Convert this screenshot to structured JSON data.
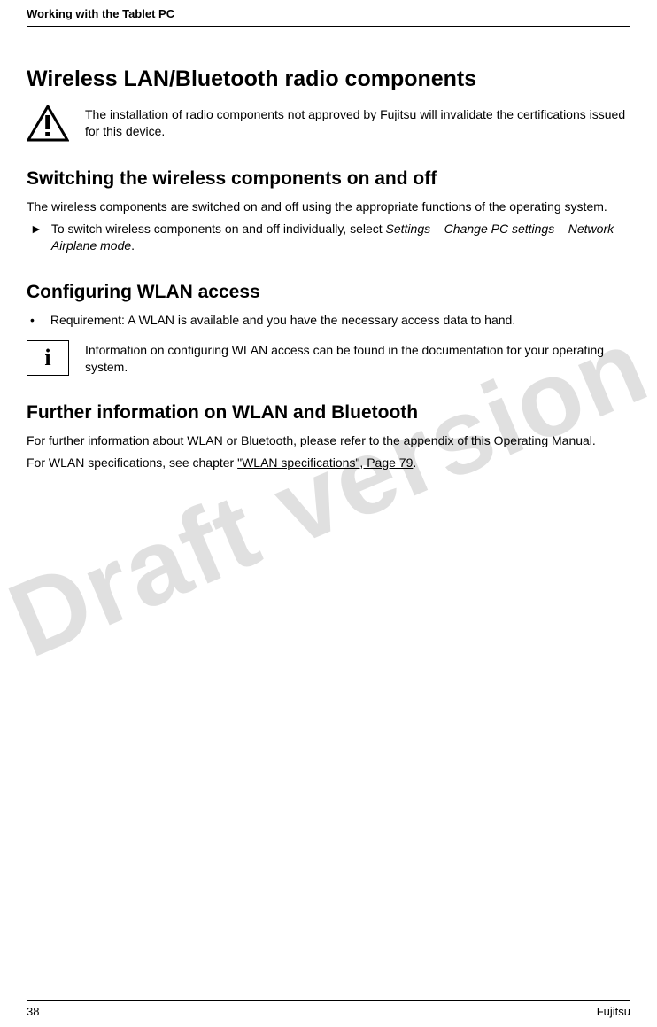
{
  "header": {
    "section_title": "Working with the Tablet PC"
  },
  "watermark": "Draft version",
  "main": {
    "h1": "Wireless LAN/Bluetooth radio components",
    "warning_text": "The installation of radio components not approved by Fujitsu will invalidate the certifications issued for this device.",
    "h2_switching": "Switching the wireless components on and off",
    "switching_intro": "The wireless components are switched on and off using the appropriate functions of the operating system.",
    "switching_step_prefix": "To switch wireless components on and off individually, select ",
    "switching_step_path": "Settings – Change PC settings – Network – Airplane mode",
    "switching_step_suffix": ".",
    "h2_configuring": "Configuring WLAN access",
    "configuring_bullet": "Requirement: A WLAN is available and you have the necessary access data to hand.",
    "info_text": "Information on configuring WLAN access can be found in the documentation for your operating system.",
    "h2_further": "Further information on WLAN and Bluetooth",
    "further_p1": "For further information about WLAN or Bluetooth, please refer to the appendix of this Operating Manual.",
    "further_p2_prefix": "For WLAN specifications, see chapter ",
    "further_link": "\"WLAN specifications\", Page 79",
    "further_p2_suffix": "."
  },
  "footer": {
    "page_number": "38",
    "brand": "Fujitsu"
  }
}
